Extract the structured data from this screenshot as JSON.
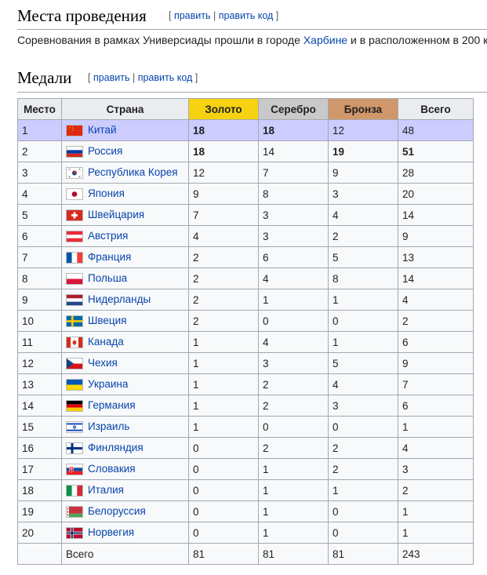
{
  "section_venues": {
    "title": "Места проведения",
    "edit_open": "[ ",
    "edit_link": "править",
    "edit_sep": " | ",
    "edit_code": "править код",
    "edit_close": " ]"
  },
  "paragraph": {
    "text_before": "Соревнования в рамках Универсиады прошли в городе ",
    "link": "Харбине",
    "text_after": " и в расположенном в 200 к"
  },
  "section_medals": {
    "title": "Медали",
    "edit_open": "[ ",
    "edit_link": "править",
    "edit_sep": " | ",
    "edit_code": "править код",
    "edit_close": " ]"
  },
  "table": {
    "headers": [
      "Место",
      "Страна",
      "Золото",
      "Серебро",
      "Бронза",
      "Всего"
    ],
    "header_colors": {
      "gold": "#f7d211",
      "silver": "#c9c9c9",
      "bronze": "#d0976a"
    },
    "host_row_color": "#ccccff",
    "rows": [
      {
        "rank": "1",
        "country": "Китай",
        "flag": "cn",
        "gold": "18",
        "silver": "18",
        "bronze": "12",
        "total": "48",
        "bold": [
          "gold",
          "silver"
        ],
        "host": true
      },
      {
        "rank": "2",
        "country": "Россия",
        "flag": "ru",
        "gold": "18",
        "silver": "14",
        "bronze": "19",
        "total": "51",
        "bold": [
          "gold",
          "bronze",
          "total"
        ]
      },
      {
        "rank": "3",
        "country": "Республика Корея",
        "flag": "kr",
        "gold": "12",
        "silver": "7",
        "bronze": "9",
        "total": "28"
      },
      {
        "rank": "4",
        "country": "Япония",
        "flag": "jp",
        "gold": "9",
        "silver": "8",
        "bronze": "3",
        "total": "20"
      },
      {
        "rank": "5",
        "country": "Швейцария",
        "flag": "ch",
        "gold": "7",
        "silver": "3",
        "bronze": "4",
        "total": "14"
      },
      {
        "rank": "6",
        "country": "Австрия",
        "flag": "at",
        "gold": "4",
        "silver": "3",
        "bronze": "2",
        "total": "9"
      },
      {
        "rank": "7",
        "country": "Франция",
        "flag": "fr",
        "gold": "2",
        "silver": "6",
        "bronze": "5",
        "total": "13"
      },
      {
        "rank": "8",
        "country": "Польша",
        "flag": "pl",
        "gold": "2",
        "silver": "4",
        "bronze": "8",
        "total": "14"
      },
      {
        "rank": "9",
        "country": "Нидерланды",
        "flag": "nl",
        "gold": "2",
        "silver": "1",
        "bronze": "1",
        "total": "4"
      },
      {
        "rank": "10",
        "country": "Швеция",
        "flag": "se",
        "gold": "2",
        "silver": "0",
        "bronze": "0",
        "total": "2"
      },
      {
        "rank": "11",
        "country": "Канада",
        "flag": "ca",
        "gold": "1",
        "silver": "4",
        "bronze": "1",
        "total": "6"
      },
      {
        "rank": "12",
        "country": "Чехия",
        "flag": "cz",
        "gold": "1",
        "silver": "3",
        "bronze": "5",
        "total": "9"
      },
      {
        "rank": "13",
        "country": "Украина",
        "flag": "ua",
        "gold": "1",
        "silver": "2",
        "bronze": "4",
        "total": "7"
      },
      {
        "rank": "14",
        "country": "Германия",
        "flag": "de",
        "gold": "1",
        "silver": "2",
        "bronze": "3",
        "total": "6"
      },
      {
        "rank": "15",
        "country": "Израиль",
        "flag": "il",
        "gold": "1",
        "silver": "0",
        "bronze": "0",
        "total": "1"
      },
      {
        "rank": "16",
        "country": "Финляндия",
        "flag": "fi",
        "gold": "0",
        "silver": "2",
        "bronze": "2",
        "total": "4"
      },
      {
        "rank": "17",
        "country": "Словакия",
        "flag": "sk",
        "gold": "0",
        "silver": "1",
        "bronze": "2",
        "total": "3"
      },
      {
        "rank": "18",
        "country": "Италия",
        "flag": "it",
        "gold": "0",
        "silver": "1",
        "bronze": "1",
        "total": "2"
      },
      {
        "rank": "19",
        "country": "Белоруссия",
        "flag": "by",
        "gold": "0",
        "silver": "1",
        "bronze": "0",
        "total": "1"
      },
      {
        "rank": "20",
        "country": "Норвегия",
        "flag": "no",
        "gold": "0",
        "silver": "1",
        "bronze": "0",
        "total": "1"
      }
    ],
    "total_row": {
      "label": "Всего",
      "gold": "81",
      "silver": "81",
      "bronze": "81",
      "total": "243"
    }
  }
}
